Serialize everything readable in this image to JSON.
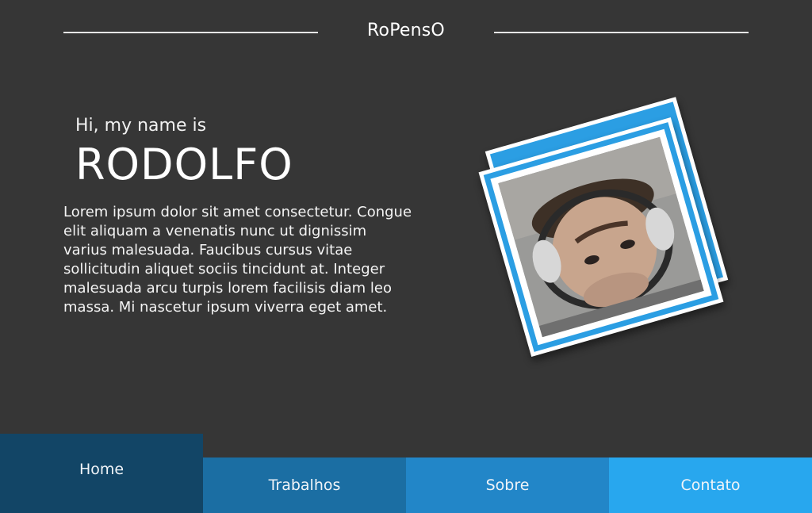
{
  "header": {
    "brand": "RoPensO"
  },
  "hero": {
    "greeting": "Hi, my name is",
    "name": "RODOLFO",
    "bio": "Lorem ipsum dolor sit amet consectetur. Congue elit aliquam a venenatis nunc ut dignissim varius malesuada. Faucibus cursus vitae sollicitudin aliquet sociis tincidunt at. Integer malesuada arcu turpis lorem facilisis diam leo massa. Mi nascetur ipsum viverra eget amet."
  },
  "nav": {
    "items": [
      {
        "label": "Home"
      },
      {
        "label": "Trabalhos"
      },
      {
        "label": "Sobre"
      },
      {
        "label": "Contato"
      }
    ]
  },
  "colors": {
    "background": "#363636",
    "nav_home": "#124566",
    "nav_trabalhos": "#1b6ea3",
    "nav_sobre": "#2286c8",
    "nav_contato": "#28a7ee",
    "photo_frame_accent": "#2b9ee3"
  }
}
